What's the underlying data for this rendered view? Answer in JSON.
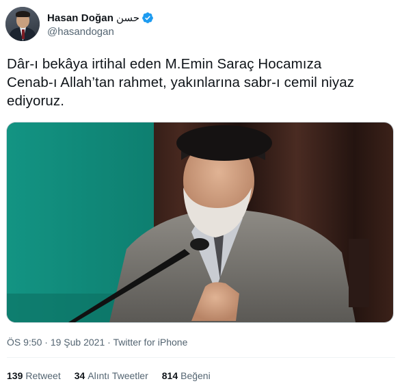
{
  "tweet": {
    "author": {
      "display_name": "Hasan Doğan",
      "arabic_name": "حسن",
      "handle": "@hasandogan",
      "verified": true,
      "verified_icon": "verified-badge-icon"
    },
    "text_lines": [
      "Dâr-ı bekâya irtihal eden M.Emin Saraç Hocamıza",
      "Cenab-ı Allah’tan rahmet, yakınlarına sabr-ı cemil niyaz",
      "ediyoruz."
    ],
    "media": {
      "kind": "photo"
    },
    "meta": {
      "time": "ÖS 9:50",
      "separator": " · ",
      "date": "19 Şub 2021",
      "source": "Twitter for iPhone"
    },
    "stats": {
      "retweets_count": "139",
      "retweets_label": "Retweet",
      "quotes_count": "34",
      "quotes_label": "Alıntı Tweetler",
      "likes_count": "814",
      "likes_label": "Beğeni"
    },
    "colors": {
      "text_primary": "#0f1419",
      "text_secondary": "#536471",
      "verified_blue": "#1d9bf0",
      "divider": "#eff3f4"
    }
  }
}
